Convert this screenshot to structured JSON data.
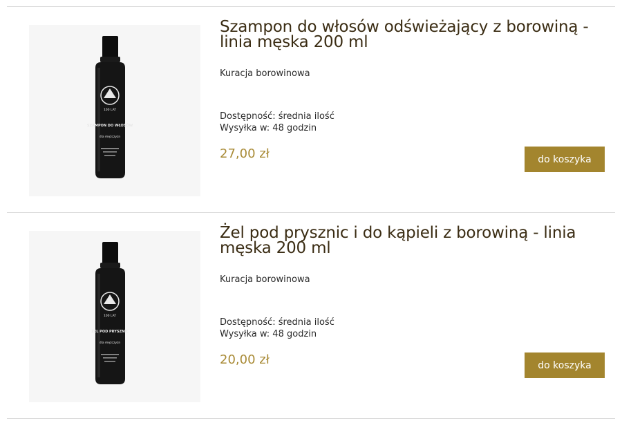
{
  "products": [
    {
      "title": "Szampon do włosów odświeżający z borowiną - linia męska 200 ml",
      "category": "Kuracja borowinowa",
      "availability": "Dostępność: średnia ilość",
      "shipping": "Wysyłka w: 48 godzin",
      "price": "27,00 zł",
      "cart_label": "do koszyka",
      "image": {
        "icon": "shampoo-bottle-image",
        "label_lines": [
          "100 LAT",
          "SZAMPON DO WŁOSÓW",
          "dla mężczyzn"
        ]
      }
    },
    {
      "title": "Żel pod prysznic i do kąpieli z borowiną - linia męska 200 ml",
      "category": "Kuracja borowinowa",
      "availability": "Dostępność: średnia ilość",
      "shipping": "Wysyłka w: 48 godzin",
      "price": "20,00 zł",
      "cart_label": "do koszyka",
      "image": {
        "icon": "shower-gel-bottle-image",
        "label_lines": [
          "100 LAT",
          "ŻEL POD PRYSZNIC",
          "dla mężczyzn"
        ]
      }
    }
  ],
  "colors": {
    "accent": "#a3852e",
    "price": "#a88a35",
    "title": "#3b2d14",
    "divider": "#dcdcdc",
    "bottle": "#151515"
  }
}
